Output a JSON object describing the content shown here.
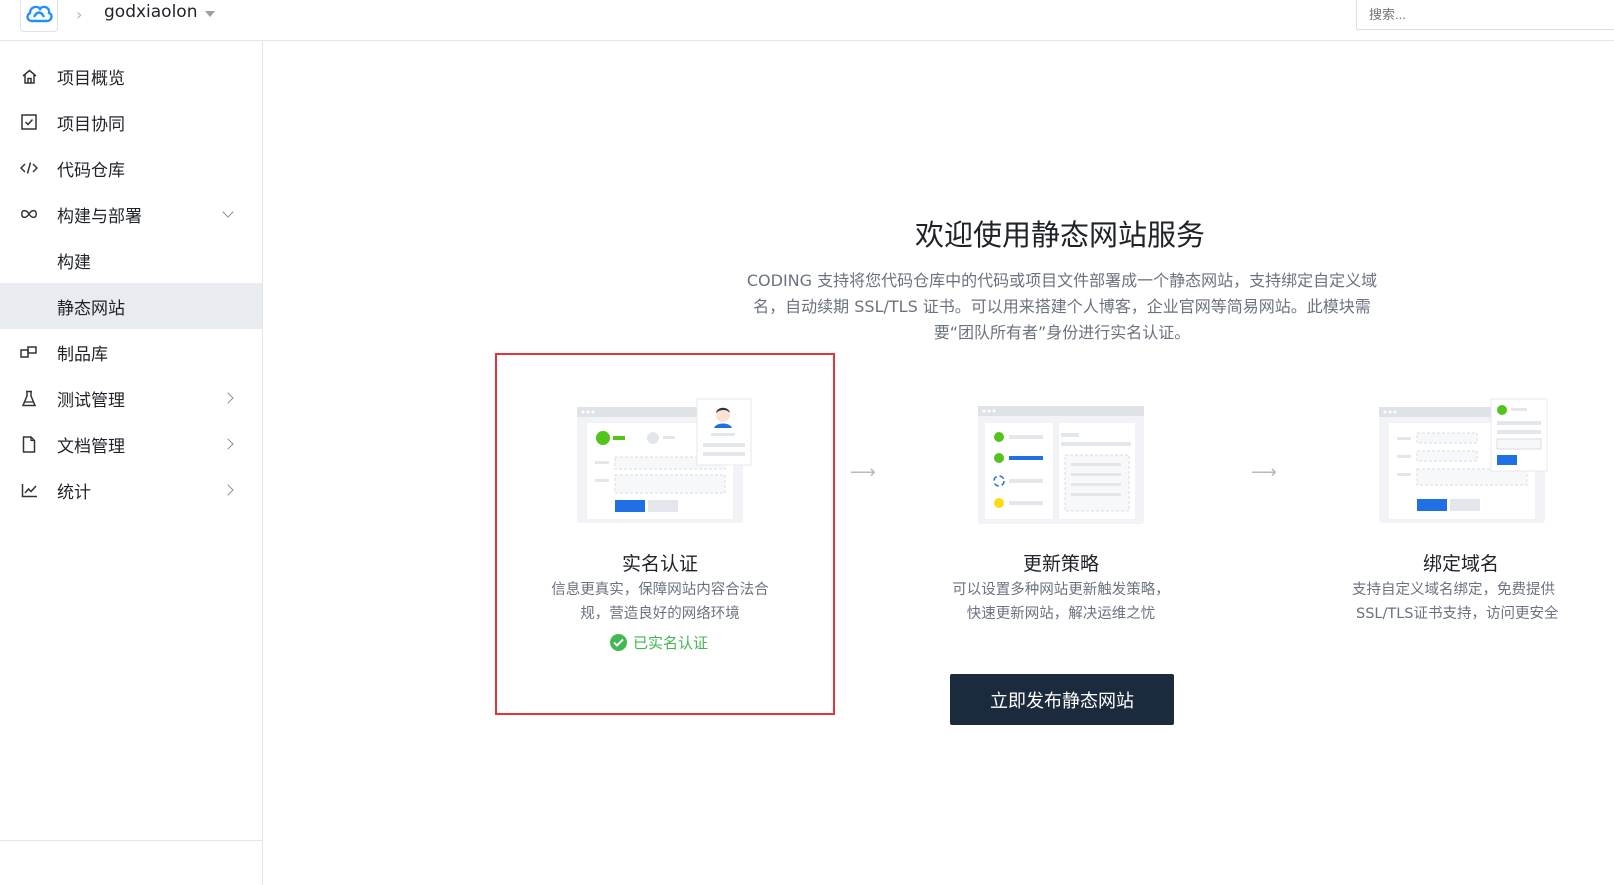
{
  "header": {
    "project_name": "godxiaolon",
    "search_placeholder": "搜索..."
  },
  "sidebar": {
    "items": [
      {
        "label": "项目概览",
        "icon": "home-icon"
      },
      {
        "label": "项目协同",
        "icon": "checkbox-icon"
      },
      {
        "label": "代码仓库",
        "icon": "code-icon"
      },
      {
        "label": "构建与部署",
        "icon": "infinity-icon",
        "expanded": true
      },
      {
        "label": "构建",
        "sub": true
      },
      {
        "label": "静态网站",
        "sub": true,
        "active": true
      },
      {
        "label": "制品库",
        "icon": "package-icon"
      },
      {
        "label": "测试管理",
        "icon": "flask-icon"
      },
      {
        "label": "文档管理",
        "icon": "document-icon"
      },
      {
        "label": "统计",
        "icon": "chart-icon"
      }
    ]
  },
  "main": {
    "title": "欢迎使用静态网站服务",
    "intro_lines": [
      "CODING 支持将您代码仓库中的代码或项目文件部署成一个静态网站，支持绑定自定义域",
      "名，自动续期 SSL/TLS 证书。可以用来搭建个人博客，企业官网等简易网站。此模块需",
      "要“团队所有者”身份进行实名认证。"
    ],
    "cards": [
      {
        "title": "实名认证",
        "desc": [
          "信息更真实，保障网站内容合法合",
          "规，营造良好的网络环境"
        ],
        "status": "已实名认证"
      },
      {
        "title": "更新策略",
        "desc": [
          "可以设置多种网站更新触发策略，",
          "快速更新网站，解决运维之忧"
        ]
      },
      {
        "title": "绑定域名",
        "desc": [
          "支持自定义域名绑定，免费提供",
          "SSL/TLS证书支持，访问更安全"
        ]
      }
    ],
    "publish_button": "立即发布静态网站"
  },
  "colors": {
    "primary_dark": "#1c2a3e",
    "success": "#3fb950",
    "highlight_border": "#e5333b",
    "accent_blue": "#1f6fe5"
  }
}
